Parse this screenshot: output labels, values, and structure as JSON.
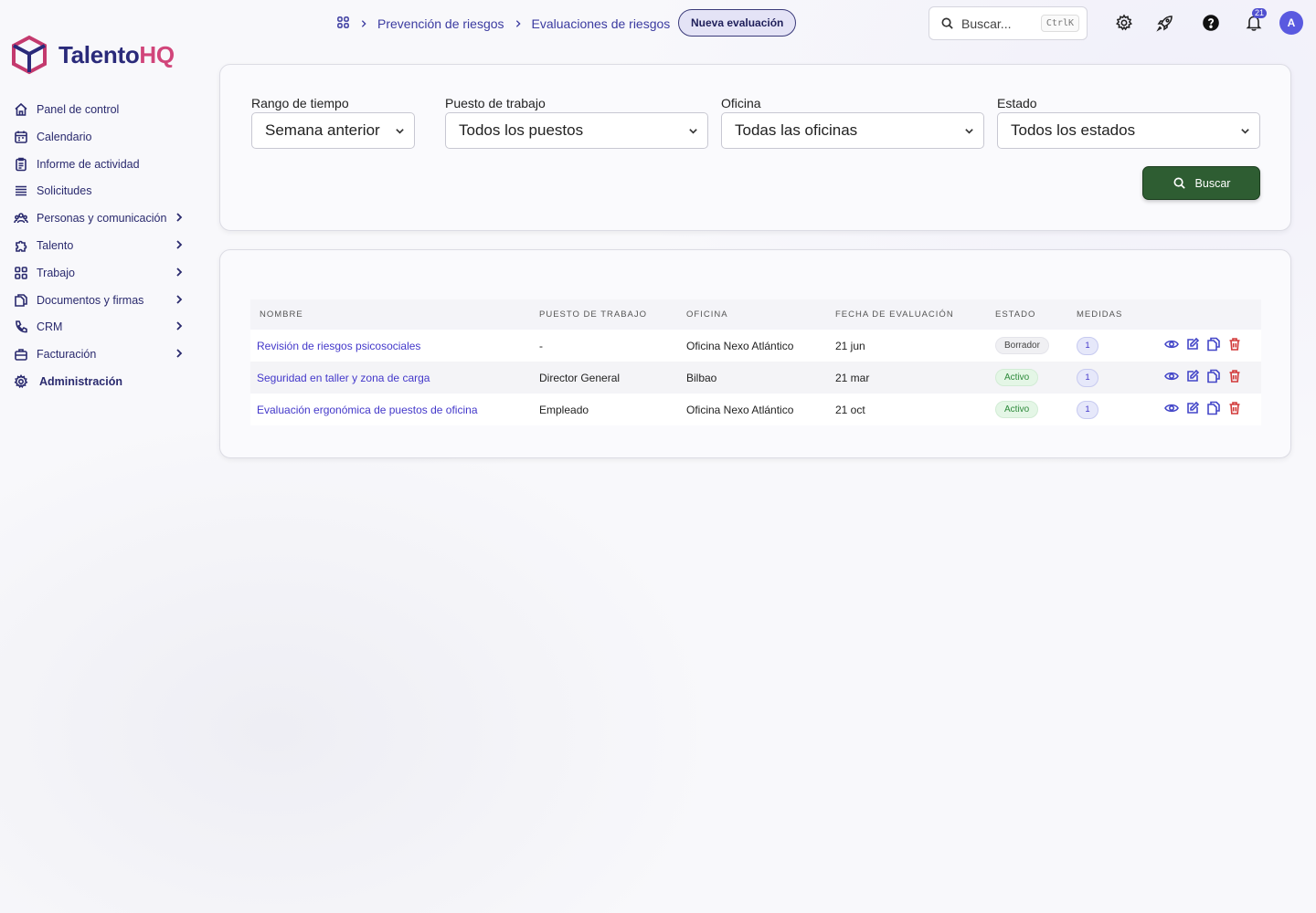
{
  "app": {
    "logo_main": "Talento",
    "logo_accent": "HQ"
  },
  "sidebar": {
    "items": [
      {
        "label": "Panel de control",
        "icon": "home-icon"
      },
      {
        "label": "Calendario",
        "icon": "calendar-icon"
      },
      {
        "label": "Informe de actividad",
        "icon": "report-icon"
      },
      {
        "label": "Solicitudes",
        "icon": "list-icon"
      },
      {
        "label": "Personas y comunicación",
        "icon": "people-icon"
      },
      {
        "label": "Talento",
        "icon": "puzzle-icon"
      },
      {
        "label": "Trabajo",
        "icon": "grid-icon"
      },
      {
        "label": "Documentos y firmas",
        "icon": "documents-icon"
      },
      {
        "label": "CRM",
        "icon": "phone-icon"
      },
      {
        "label": "Facturación",
        "icon": "briefcase-icon"
      },
      {
        "label": "Administración",
        "icon": "gear-icon"
      }
    ]
  },
  "breadcrumb": {
    "section": "Prevención de riesgos",
    "page": "Evaluaciones de riesgos"
  },
  "header": {
    "new_button": "Nueva evaluación",
    "search_placeholder": "Buscar...",
    "search_shortcut": "CtrlK",
    "notifications_count": "21",
    "avatar_initial": "A"
  },
  "filters": {
    "time": {
      "label": "Rango de tiempo",
      "value": "Semana anterior"
    },
    "job": {
      "label": "Puesto de trabajo",
      "value": "Todos los puestos"
    },
    "office": {
      "label": "Oficina",
      "value": "Todas las oficinas"
    },
    "status": {
      "label": "Estado",
      "value": "Todos los estados"
    },
    "search_button": "Buscar"
  },
  "table": {
    "columns": {
      "name": "NOMBRE",
      "job": "PUESTO DE TRABAJO",
      "office": "OFICINA",
      "date": "FECHA DE EVALUACIÓN",
      "status": "ESTADO",
      "measures": "MEDIDAS"
    },
    "rows": [
      {
        "name": "Revisión de riesgos psicosociales",
        "job": "-",
        "office": "Oficina Nexo Atlántico",
        "date": "21 jun",
        "status": "Borrador",
        "measures": "1"
      },
      {
        "name": "Seguridad en taller y zona de carga",
        "job": "Director General",
        "office": "Bilbao",
        "date": "21 mar",
        "status": "Activo",
        "measures": "1"
      },
      {
        "name": "Evaluación ergonómica de puestos de oficina",
        "job": "Empleado",
        "office": "Oficina Nexo Atlántico",
        "date": "21 oct",
        "status": "Activo",
        "measures": "1"
      }
    ]
  },
  "colors": {
    "primary": "#4338ca",
    "success": "#2e5d32",
    "danger": "#d23a3a",
    "accent": "#d1457a"
  }
}
